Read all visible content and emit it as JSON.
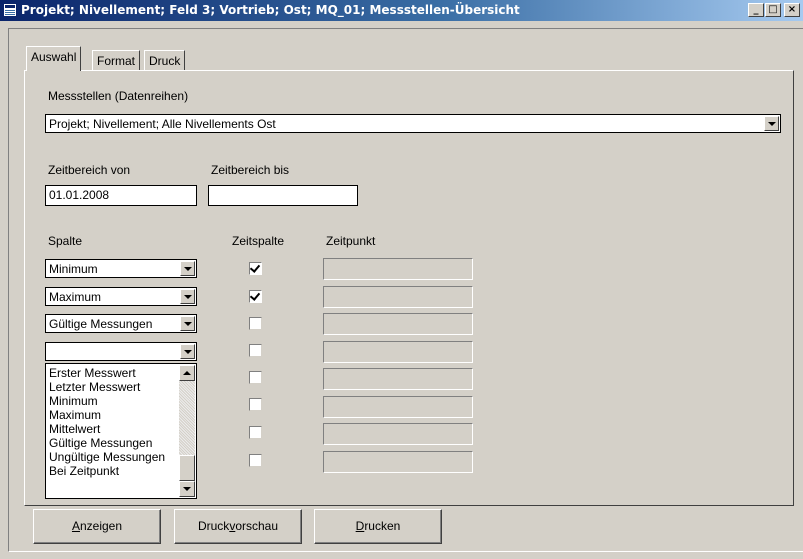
{
  "window": {
    "title": "Projekt; Nivellement; Feld 3; Vortrieb; Ost; MQ_01; Messstellen-Übersicht",
    "minimize_glyph": "_",
    "maximize_glyph": "□",
    "close_glyph": "×"
  },
  "tabs": [
    {
      "label": "Auswahl",
      "active": true
    },
    {
      "label": "Format",
      "active": false
    },
    {
      "label": "Druck",
      "active": false
    }
  ],
  "messstellen": {
    "label": "Messstellen (Datenreihen)",
    "value": "Projekt; Nivellement; Alle Nivellements Ost"
  },
  "zeitbereich": {
    "von_label": "Zeitbereich von",
    "von_value": "01.01.2008",
    "bis_label": "Zeitbereich bis",
    "bis_value": ""
  },
  "columns_header": {
    "spalte": "Spalte",
    "zeitspalte": "Zeitspalte",
    "zeitpunkt": "Zeitpunkt"
  },
  "rows": [
    {
      "spalte": "Minimum",
      "zeitspalte": true
    },
    {
      "spalte": "Maximum",
      "zeitspalte": true
    },
    {
      "spalte": "Gültige Messungen",
      "zeitspalte": false
    },
    {
      "spalte": "",
      "zeitspalte": false
    },
    {
      "spalte": "",
      "zeitspalte": false
    },
    {
      "spalte": "",
      "zeitspalte": false
    },
    {
      "spalte": "",
      "zeitspalte": false
    },
    {
      "spalte": "",
      "zeitspalte": false
    }
  ],
  "dropdown_list": {
    "items": [
      "Erster Messwert",
      "Letzter Messwert",
      "Minimum",
      "Maximum",
      "Mittelwert",
      "Gültige Messungen",
      "Ungültige Messungen",
      "Bei Zeitpunkt"
    ]
  },
  "buttons": {
    "anzeigen": {
      "pre": "",
      "key": "A",
      "post": "nzeigen"
    },
    "druckvorschau": {
      "pre": "Druck",
      "key": "v",
      "post": "orschau"
    },
    "drucken": {
      "pre": "",
      "key": "D",
      "post": "rucken"
    }
  },
  "colors": {
    "titlebar_start": "#0a246a",
    "titlebar_end": "#a6caf0",
    "face": "#d4d0c8"
  }
}
